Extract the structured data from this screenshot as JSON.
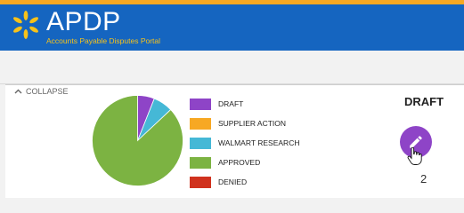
{
  "header": {
    "title": "APDP",
    "subtitle": "Accounts Payable Disputes Portal",
    "logo_icon": "spark-icon",
    "colors": {
      "strip": "#f7a823",
      "bar": "#1565c0",
      "subtitle": "#f7c21a"
    }
  },
  "panel": {
    "collapse_label": "COLLAPSE",
    "status_title": "DRAFT",
    "count": "2",
    "edit_icon": "pencil-icon",
    "edit_color": "#8e44c7"
  },
  "chart_data": {
    "type": "pie",
    "categories": [
      "DRAFT",
      "SUPPLIER ACTION",
      "WALMART RESEARCH",
      "APPROVED",
      "DENIED"
    ],
    "values": [
      6,
      0,
      7,
      87,
      0
    ],
    "colors": [
      "#8e44c7",
      "#f7a823",
      "#45b8d6",
      "#7cb342",
      "#d0321e"
    ]
  }
}
